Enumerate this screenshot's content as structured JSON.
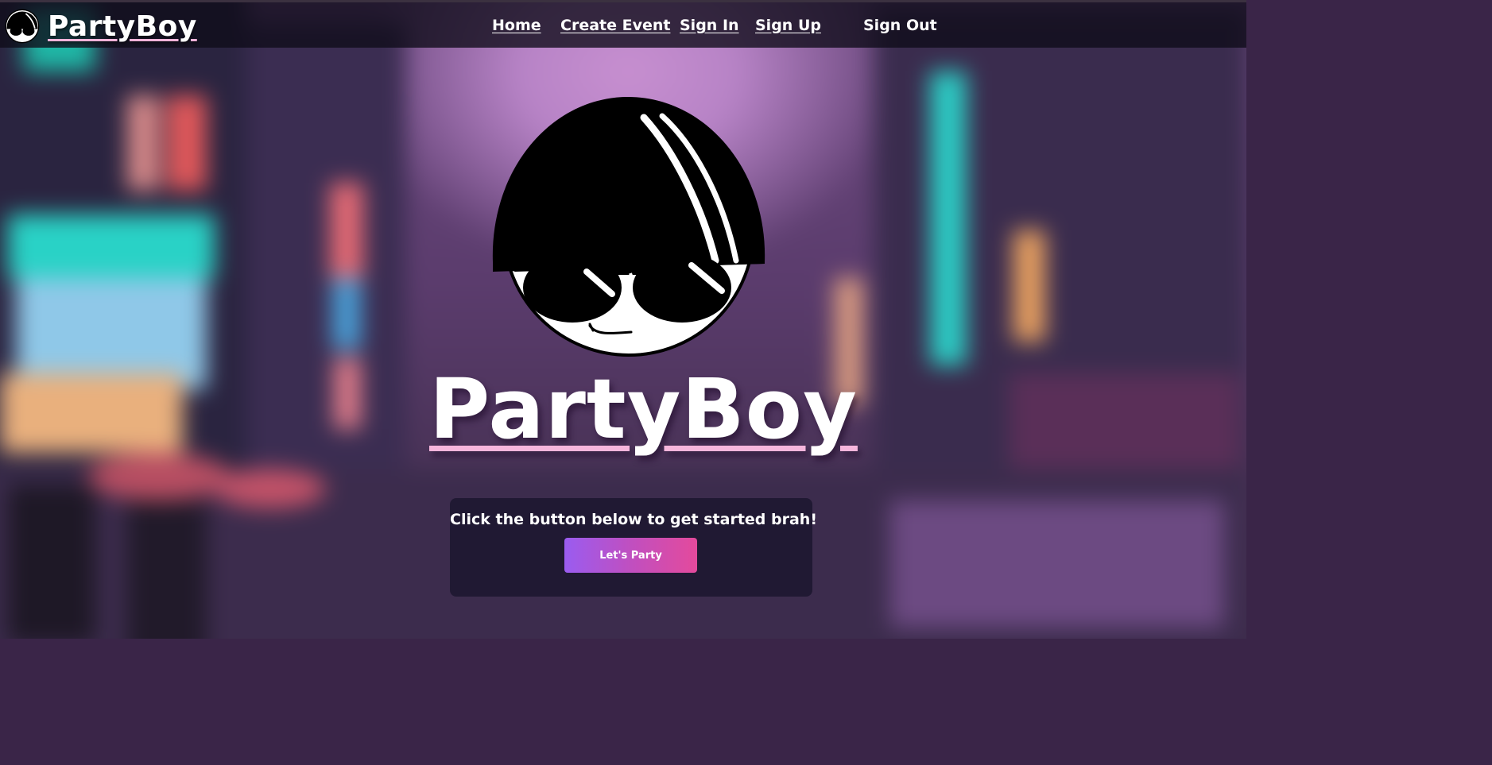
{
  "nav": {
    "brand": "PartyBoy",
    "links": [
      "Home",
      "Create Event",
      "Sign In",
      "Sign Up"
    ],
    "sign_out": "Sign Out",
    "logo_icon": "partyboy-face-icon"
  },
  "hero": {
    "title": "PartyBoy",
    "logo_icon": "partyboy-face-icon"
  },
  "cta": {
    "message": "Click the button below to get started brah!",
    "button_label": "Let's Party"
  },
  "colors": {
    "accent_pink": "#f5b3d9",
    "button_gradient_start": "#9a5cf0",
    "button_gradient_end": "#e44a9c",
    "nav_bg": "#0e0c18"
  }
}
